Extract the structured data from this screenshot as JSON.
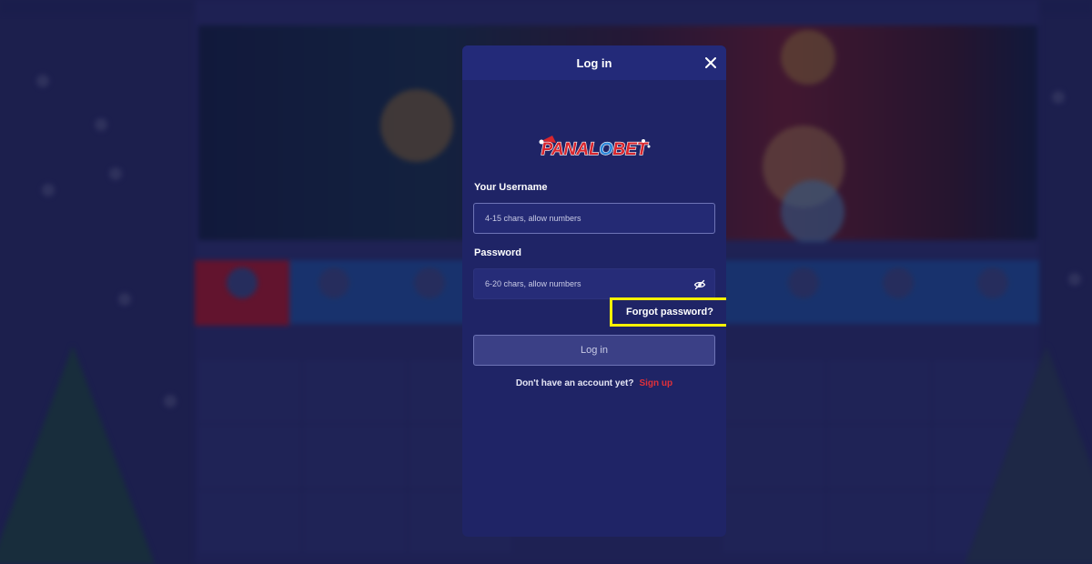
{
  "modal": {
    "title": "Log in",
    "close_icon": "close-icon",
    "logo_text": "PANALOBET",
    "username_label": "Your Username",
    "username_placeholder": "4-15 chars, allow numbers",
    "password_label": "Password",
    "password_placeholder": "6-20 chars, allow numbers",
    "password_toggle_icon": "eye-slash-icon",
    "forgot_password": "Forgot password?",
    "login_button": "Log in",
    "no_account_text": "Don't have an account yet?",
    "signup_link": "Sign up"
  },
  "colors": {
    "modal_bg": "#1f2466",
    "header_bg": "#232a79",
    "highlight": "#fff200",
    "signup": "#e0303a",
    "active_category": "#c0121d"
  }
}
